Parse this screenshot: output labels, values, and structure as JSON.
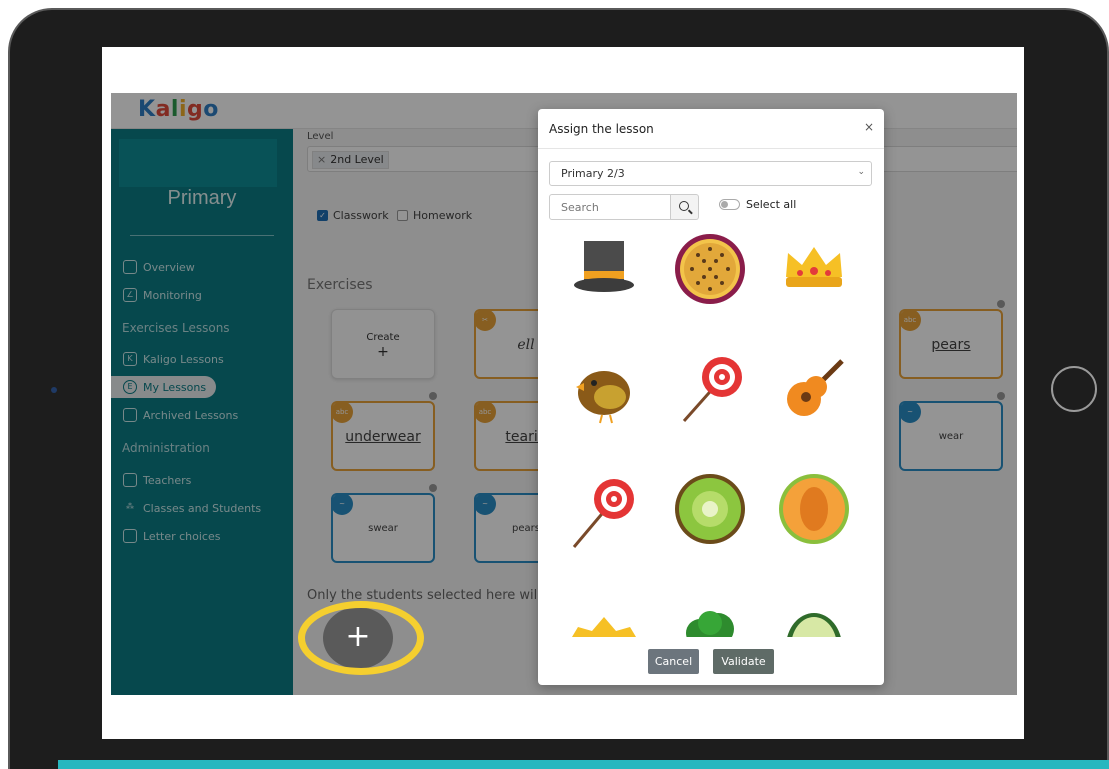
{
  "app": {
    "logo_letters": [
      "K",
      "a",
      "l",
      "i",
      "g",
      "o"
    ],
    "logo_colors": [
      "#2f7fc4",
      "#e04b3b",
      "#2f9b4f",
      "#f2b02b",
      "#e04b3b",
      "#2f7fc4"
    ]
  },
  "sidebar": {
    "class_name": "Primary",
    "items": [
      {
        "label": "Overview",
        "icon": "overview-icon"
      },
      {
        "label": "Monitoring",
        "icon": "chart-icon"
      }
    ],
    "section_lessons": "Exercises Lessons",
    "lesson_items": [
      {
        "label": "Kaligo Lessons",
        "icon": "book-icon"
      },
      {
        "label": "My Lessons",
        "icon": "my-lessons-icon",
        "active": true
      },
      {
        "label": "Archived Lessons",
        "icon": "archive-icon"
      }
    ],
    "section_admin": "Administration",
    "admin_items": [
      {
        "label": "Teachers",
        "icon": "teacher-icon"
      },
      {
        "label": "Classes and Students",
        "icon": "students-icon"
      },
      {
        "label": "Letter choices",
        "icon": "letters-icon"
      }
    ]
  },
  "main": {
    "level_label": "Level",
    "level_tag_x": "×",
    "level_tag": "2nd Level",
    "classwork_label": "Classwork",
    "classwork_checked": true,
    "homework_label": "Homework",
    "homework_checked": false,
    "exercises_title": "Exercises",
    "create_label": "Create",
    "create_plus": "+",
    "cards": [
      {
        "text": "ell",
        "type": "writing",
        "color": "orange"
      },
      {
        "text": "pears",
        "type": "reading",
        "color": "orange"
      },
      {
        "text": "underwear",
        "type": "reading",
        "color": "orange"
      },
      {
        "text": "tearin",
        "type": "reading",
        "color": "orange"
      },
      {
        "text": "wear",
        "type": "listening",
        "color": "blue"
      },
      {
        "text": "swear",
        "type": "listening",
        "color": "blue"
      },
      {
        "text": "pears",
        "type": "listening",
        "color": "blue"
      }
    ],
    "only_text": "Only the students selected here wil",
    "fab_label": "+"
  },
  "modal": {
    "title": "Assign the lesson",
    "close": "×",
    "class_select_value": "Primary 2/3",
    "search_placeholder": "Search",
    "select_all_label": "Select all",
    "select_all_on": false,
    "avatars": [
      "top-hat",
      "passion-fruit",
      "crown",
      "bird",
      "lollipop",
      "guitar",
      "lollipop",
      "kiwi",
      "melon",
      "crown",
      "broccoli",
      "avocado"
    ],
    "cancel_label": "Cancel",
    "validate_label": "Validate"
  }
}
